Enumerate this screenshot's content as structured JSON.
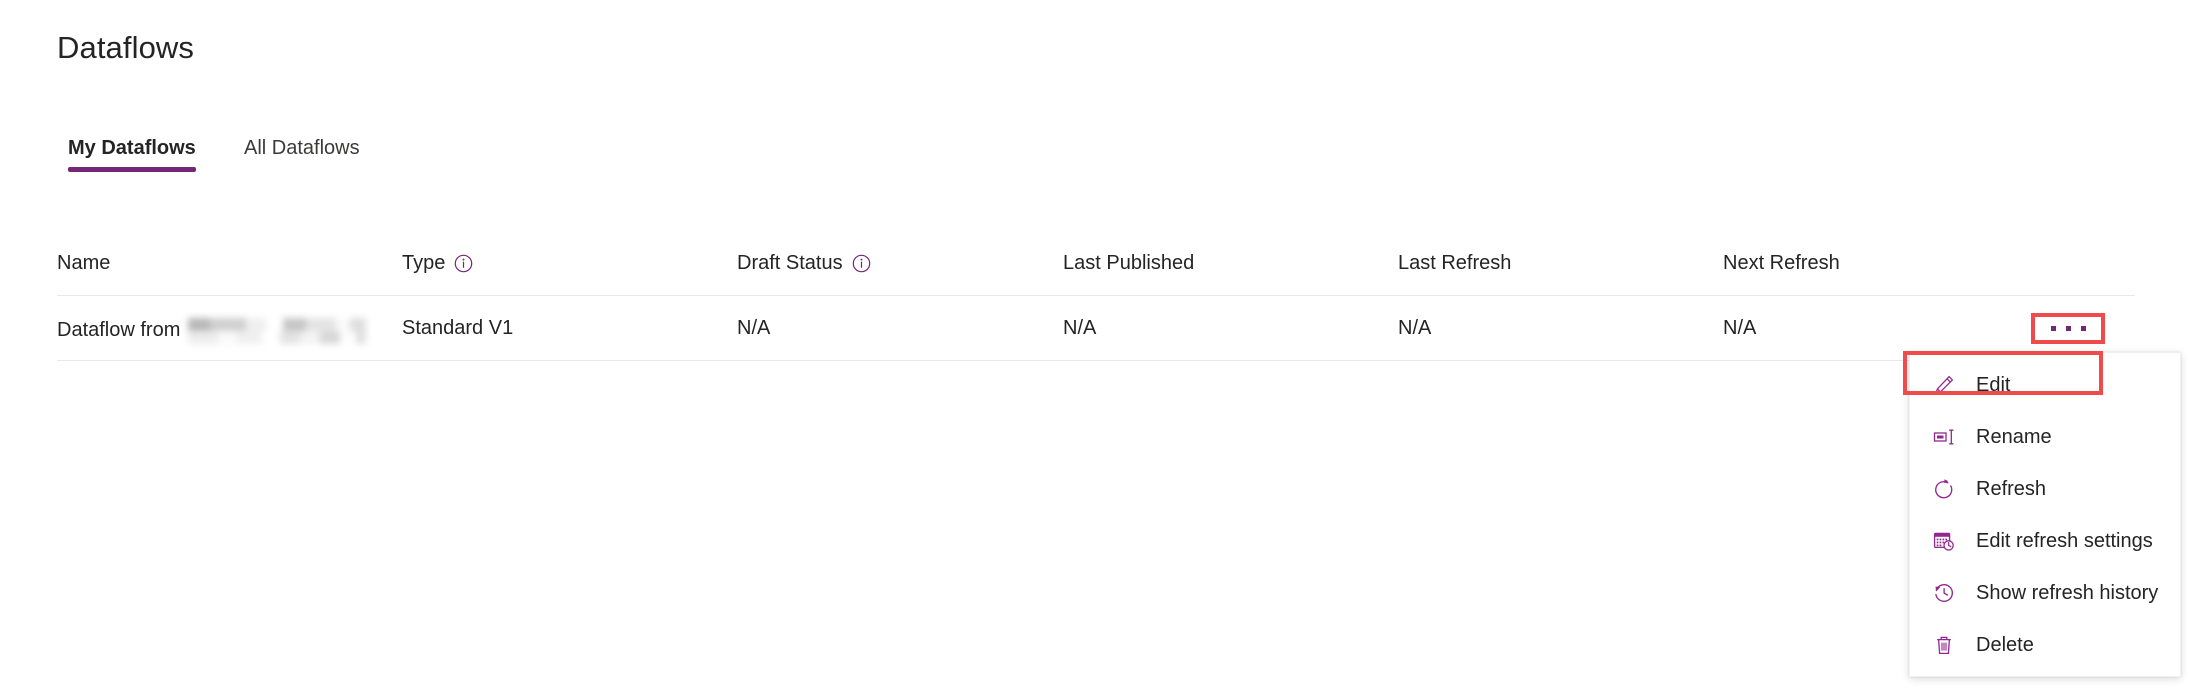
{
  "page": {
    "title": "Dataflows"
  },
  "tabs": [
    {
      "id": "my-dataflows",
      "label": "My Dataflows",
      "selected": true
    },
    {
      "id": "all-dataflows",
      "label": "All Dataflows",
      "selected": false
    }
  ],
  "table": {
    "columns": [
      {
        "id": "name",
        "label": "Name",
        "info": false
      },
      {
        "id": "type",
        "label": "Type",
        "info": true
      },
      {
        "id": "draft-status",
        "label": "Draft Status",
        "info": true
      },
      {
        "id": "last-published",
        "label": "Last Published",
        "info": false
      },
      {
        "id": "last-refresh",
        "label": "Last Refresh",
        "info": false
      },
      {
        "id": "next-refresh",
        "label": "Next Refresh",
        "info": false
      }
    ],
    "rows": [
      {
        "name_prefix": "Dataflow from",
        "name_redacted": true,
        "type": "Standard V1",
        "draft_status": "N/A",
        "last_published": "N/A",
        "last_refresh": "N/A",
        "next_refresh": "N/A",
        "overflow_label": "More options"
      }
    ]
  },
  "context_menu": {
    "items": [
      {
        "id": "edit",
        "label": "Edit",
        "icon": "pencil-icon",
        "highlighted": true
      },
      {
        "id": "rename",
        "label": "Rename",
        "icon": "rename-icon",
        "highlighted": false
      },
      {
        "id": "refresh",
        "label": "Refresh",
        "icon": "refresh-icon",
        "highlighted": false
      },
      {
        "id": "edit-refresh-settings",
        "label": "Edit refresh settings",
        "icon": "calendar-clock-icon",
        "highlighted": false
      },
      {
        "id": "show-refresh-history",
        "label": "Show refresh history",
        "icon": "history-clock-icon",
        "highlighted": false
      },
      {
        "id": "delete",
        "label": "Delete",
        "icon": "trash-icon",
        "highlighted": false
      }
    ]
  },
  "colors": {
    "accent_purple": "#742774",
    "highlight_red": "#f04b4b",
    "text_primary": "#242424",
    "divider": "#ebe9e7",
    "background": "#ffffff"
  },
  "annotations": [
    {
      "id": "ellipsis-highlight",
      "target": "overflow-menu-button",
      "color": "#f04b4b"
    },
    {
      "id": "edit-highlight",
      "target": "context-menu-item-edit",
      "color": "#f04b4b"
    }
  ]
}
